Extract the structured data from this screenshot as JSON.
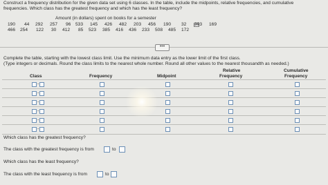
{
  "instructions": {
    "line1": "Construct a frequency distribution for the given data set using 6 classes. In the table, include the midpoints, relative frequencies, and cumulative",
    "line2": "frequencies. Which class has the greatest frequency and which has the least frequency?"
  },
  "data_table": {
    "caption": "Amount (in dollars) spent on books for a semester",
    "row1": [
      "190",
      "44",
      "292",
      "257",
      "96",
      "533",
      "145",
      "426",
      "482",
      "203",
      "456",
      "190",
      "32",
      "393",
      "169"
    ],
    "row2": [
      "466",
      "254",
      "122",
      "30",
      "412",
      "85",
      "523",
      "385",
      "416",
      "436",
      "233",
      "508",
      "485",
      "172"
    ]
  },
  "expand_button": "•••",
  "task": {
    "line1": "Complete the table, starting with the lowest class limit. Use the minimum data entry as the lower limit of the first class.",
    "line2": "(Type integers or decimals. Round the class limits to the nearest whole number. Round all other values to the nearest thousandth as needed.)"
  },
  "table_headers": {
    "class": "Class",
    "frequency": "Frequency",
    "midpoint": "Midpoint",
    "relative_top": "Relative",
    "relative_bottom": "Frequency",
    "cumulative_top": "Cumulative",
    "cumulative_bottom": "Frequency"
  },
  "dash": "-",
  "questions": {
    "q1": "Which class has the greatest frequency?",
    "a1_prefix": "The class with the greatest frequency is from",
    "to": "to",
    "q2": "Which class has the least frequency?",
    "a2_prefix": "The class with the least frequency is from"
  }
}
